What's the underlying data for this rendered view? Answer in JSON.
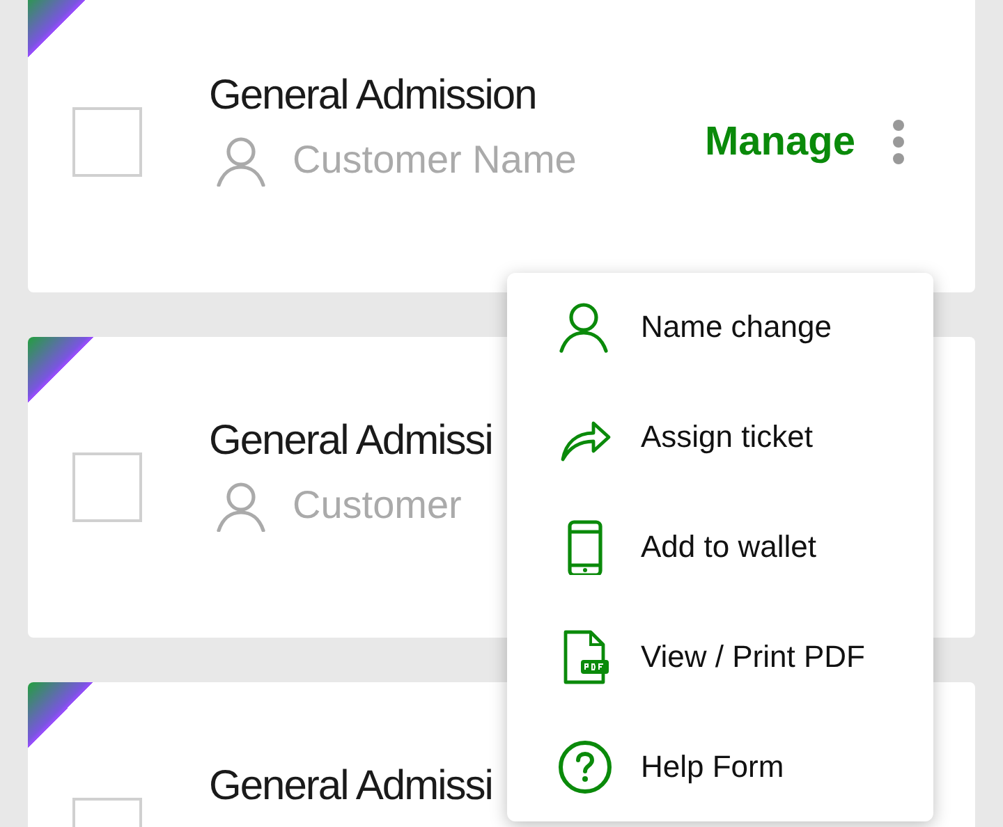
{
  "tickets": [
    {
      "title": "General Admission",
      "customer": "Customer Name",
      "checked": false,
      "action": "Manage"
    },
    {
      "title": "General Admissi",
      "customer": "Customer",
      "checked": false
    },
    {
      "title": "General Admissi",
      "checked": false
    }
  ],
  "menu": {
    "items": [
      {
        "label": "Name change"
      },
      {
        "label": "Assign ticket"
      },
      {
        "label": "Add to wallet"
      },
      {
        "label": "View / Print PDF"
      },
      {
        "label": "Help Form"
      }
    ]
  }
}
